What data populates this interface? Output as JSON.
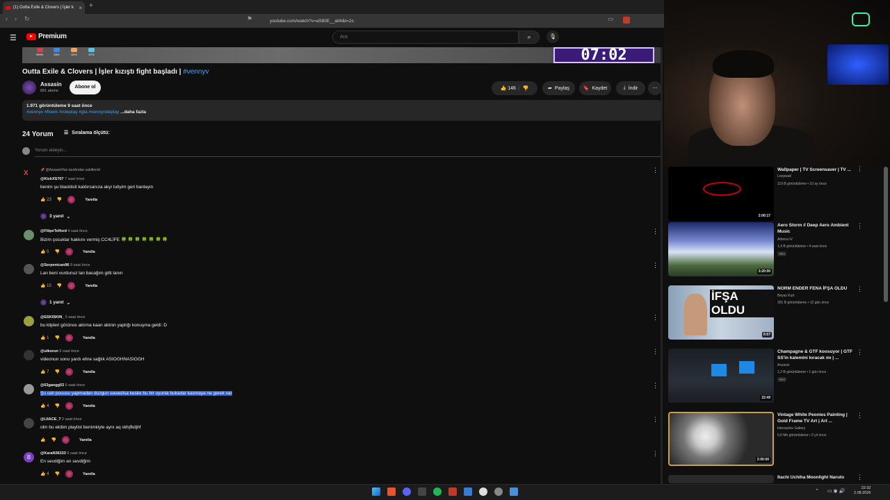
{
  "browser": {
    "tab_title": "(1) Outta Exile & Clovers | İşler k",
    "url": "youtube.com/watch?v=aS80E__alt4&t=2s"
  },
  "youtube": {
    "logo_text": "Premium",
    "search_placeholder": "Ara"
  },
  "video": {
    "timer": "07:02",
    "hud": [
      "999%",
      "63%",
      "61%",
      "67%"
    ],
    "title": "Outta Exile & Clovers | İşler kızıştı fight başladı |",
    "hashtag": "#vennyv",
    "channel": "Assasin",
    "subscribers": "891 abone",
    "subscribe_label": "Abone ol",
    "likes": "146",
    "share_label": "Paylaş",
    "save_label": "Kaydet",
    "download_label": "İndir",
    "views_line": "1.971 görüntüleme  9 saat önce",
    "tags_line": "#vennyv #fivem #roleplay #gta #vennyroleplay",
    "more_label": "...daha fazla"
  },
  "comments_header": {
    "count": "24 Yorum",
    "sort_label": "Sıralama ölçütü:",
    "add_placeholder": "Yorum ekleyin..."
  },
  "comments": [
    {
      "pinned": "@AssasinHan tarafından sabitlendi",
      "user": "@KickXS707",
      "time": "7 saat önce",
      "text": "benim şu blacklisti kaldırsanıza akyi tutiyim geri banlayin",
      "likes": "23",
      "replies": "3 yanıt"
    },
    {
      "user": "@FilipeTelford",
      "time": "4 saat önce",
      "text": "Bizim çocuklar hakkını vermiş CC4LİFE 🍀 🍀 🍀 🍀 🍀 🍀 🍀",
      "likes": "5"
    },
    {
      "user": "@Serpentcan96",
      "time": "9 saat önce",
      "text": "Lan beni vurdunuz lan bacağım gitti lanın",
      "likes": "15",
      "replies": "1 yanıt"
    },
    {
      "user": "@ESKISKIN_",
      "time": "5 saat önce",
      "text": "bu klipleri görünce aklıma kaan abinin yaptığı konuşma geldi :D",
      "likes": "1"
    },
    {
      "user": "@utkorun",
      "time": "9 saat önce",
      "text": "videonun sonu yardı eline sağlık ASIOGHNASIOGH",
      "likes": "7"
    },
    {
      "user": "@63gangg53",
      "time": "6 saat önce",
      "text": "Şu catı pususu yapmadan duzgun savasilsa keske bu bir oyunla bukadar kasmaya ne gerek var",
      "likes": "4"
    },
    {
      "user": "@LIIACE_7",
      "time": "2 saat önce",
      "text": "olm bu ekibin playlist benimkiyle aynı aq skhjfkdjhf",
      "likes": ""
    },
    {
      "user": "@KaraN36333",
      "time": "9 saat önce",
      "text": "En sevdiğim en sevdiğim",
      "likes": "4"
    }
  ],
  "reply_label": "Yanıtla",
  "recommendations": [
    {
      "title": "Wallpaper | TV Screensaver | TV ...",
      "channel": "Loopwall",
      "meta": "119 B görüntüleme  •  10 ay önce",
      "duration": "2:00:17"
    },
    {
      "title": "Aero Storm // Deep Aero Ambient Music",
      "channel": "Athena IV",
      "meta": "1,4 B görüntüleme  •  4 saat önce",
      "badge": "Yeni",
      "duration": "3:20:00"
    },
    {
      "title": "NORM ENDER FENA İFŞA OLDU",
      "channel": "Beyaz Kurt",
      "meta": "301 B görüntüleme  •  12 gün önce",
      "duration": "6:57",
      "thumb_text": "İFŞA OLDU"
    },
    {
      "title": "Champagne & GTF koosuyor | GTF SS'in kalemini kıracak mı | ...",
      "channel": "Assasin",
      "meta": "1,2 B görüntüleme  •  1 gün önce",
      "badge": "Yeni",
      "duration": "22:49"
    },
    {
      "title": "Vintage White Peonies Painting | Gold Frame TV Art | Art ...",
      "channel": "Interactive Gallery",
      "meta": "5,6 Mn görüntüleme  •  2 yıl önce",
      "duration": "2:00:00"
    },
    {
      "title": "Itachi Uchiha Moonlight Naruto",
      "channel": "",
      "meta": "",
      "duration": ""
    }
  ],
  "clock": {
    "time": "22:32",
    "date": "2.08.2026"
  },
  "colors": {
    "bg": "#0f0f0f",
    "accent": "#ff0000",
    "link": "#3ea6ff",
    "highlight": "#2f5bd8"
  }
}
